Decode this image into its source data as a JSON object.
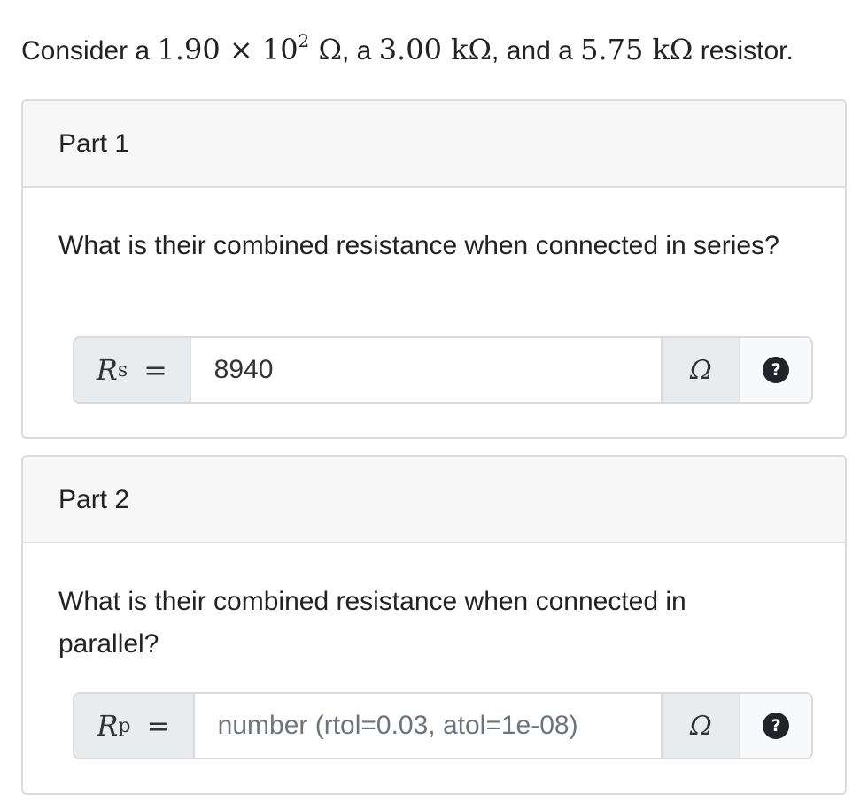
{
  "intro": {
    "prefix": "Consider a ",
    "r1_mantissa": "1.90 × 10",
    "r1_exponent": "2",
    "r1_unit": " Ω",
    "sep1": ", a ",
    "r2": "3.00 kΩ",
    "sep2": ", and a ",
    "r3": "5.75 kΩ",
    "suffix": " resistor."
  },
  "parts": [
    {
      "title": "Part 1",
      "question": "What is their combined resistance when connected in series?",
      "label_var": "R",
      "label_sub": "s",
      "label_eq": "=",
      "input_value": "8940",
      "input_placeholder": "",
      "unit": "Ω",
      "help_icon": "?"
    },
    {
      "title": "Part 2",
      "question": "What is their combined resistance when connected in parallel?",
      "label_var": "R",
      "label_sub": "p",
      "label_eq": "=",
      "input_value": "",
      "input_placeholder": "number (rtol=0.03, atol=1e-08)",
      "unit": "Ω",
      "help_icon": "?"
    }
  ]
}
